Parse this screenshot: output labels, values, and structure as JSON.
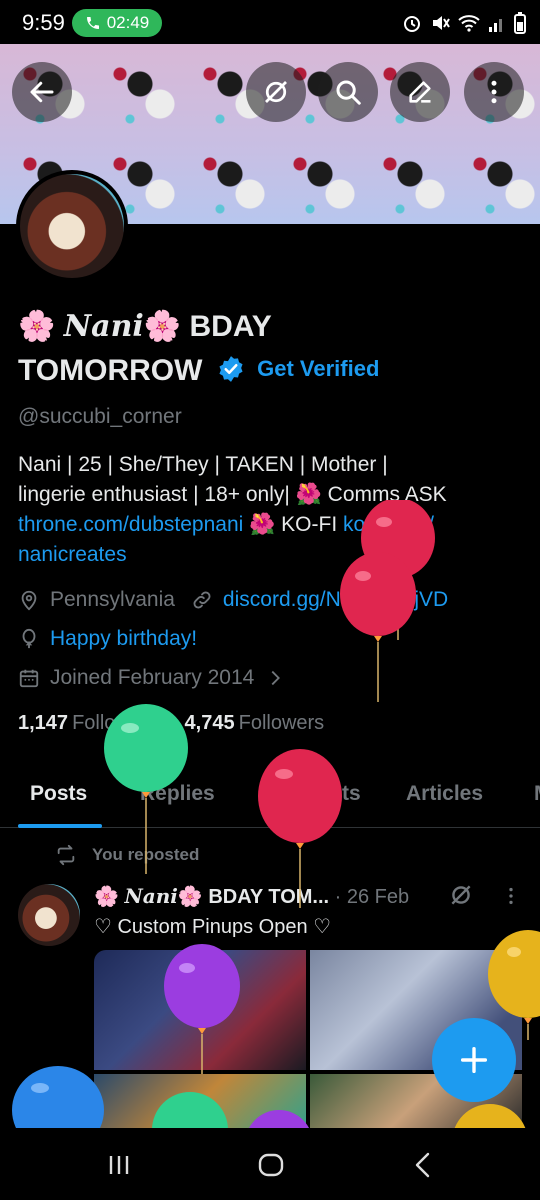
{
  "status_bar": {
    "time": "9:59",
    "call_timer": "02:49"
  },
  "profile": {
    "name_emoji": "🌸",
    "name_styled": "Nani",
    "name_line1_rest": "BDAY",
    "name_line2": "TOMORROW",
    "get_verified": "Get Verified",
    "handle": "@succubi_corner",
    "bio_line1": "Nani | 25 | She/They | TAKEN | Mother |",
    "bio_line2": "lingerie enthusiast | 18+ only| 🌺 Comms ASK",
    "bio_link1": "throne.com/dubstepnani",
    "bio_mid": "🌺 KO-FI",
    "bio_link2": "ko-fi.com/",
    "bio_link2b": "nanicreates",
    "location": "Pennsylvania",
    "website": "discord.gg/NTPg9d2jVD",
    "birthday": "Happy birthday!",
    "joined": "Joined February 2014",
    "following_count": "1,147",
    "following_label": "Following",
    "followers_count": "4,745",
    "followers_label": "Followers"
  },
  "tabs": [
    "Posts",
    "Replies",
    "Highlights",
    "Articles",
    "M"
  ],
  "post": {
    "repost_label": "You reposted",
    "name_prefix": "🌸",
    "name_styled": "Nani",
    "name_suffix": "🌸 BDAY TOM...",
    "date": "· 26 Feb",
    "text": "♡ Custom Pinups Open ♡"
  },
  "colors": {
    "accent": "#1d9bf0",
    "background": "#000000",
    "muted": "#71767b",
    "call_green": "#2fb75a"
  },
  "icons": [
    "back-arrow-icon",
    "grok-icon",
    "search-icon",
    "edit-icon",
    "more-icon",
    "verified-icon",
    "location-icon",
    "link-icon",
    "balloon-icon",
    "calendar-icon",
    "chevron-right-icon",
    "repost-icon",
    "plus-icon"
  ]
}
